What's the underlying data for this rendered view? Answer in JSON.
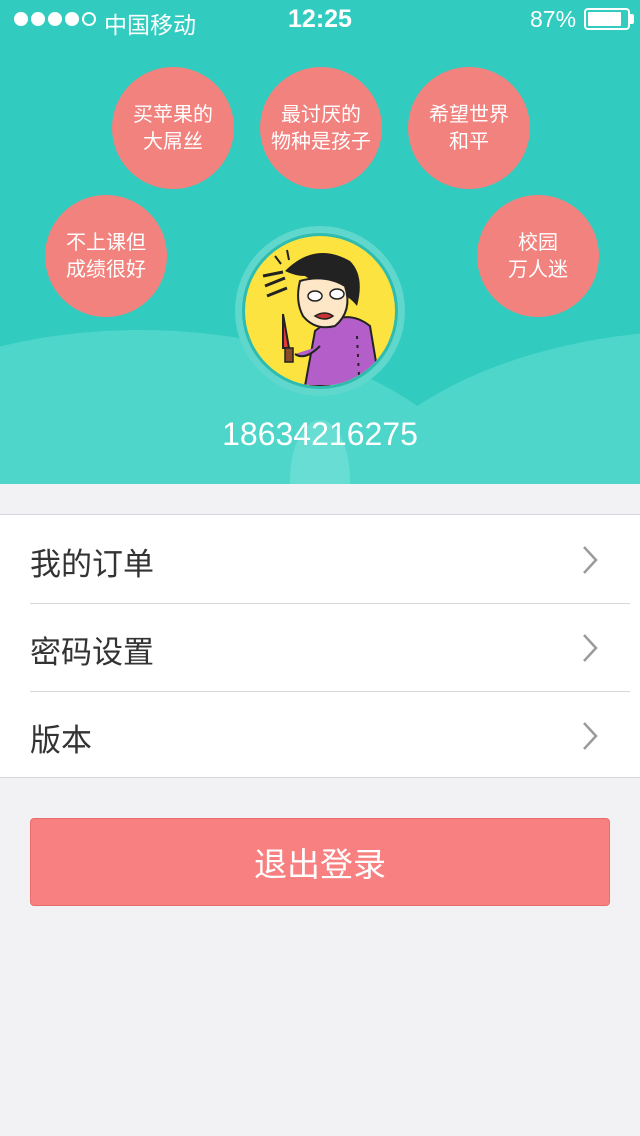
{
  "status_bar": {
    "carrier": "中国移动",
    "time": "12:25",
    "battery_percent": "87%",
    "battery_level": 0.87,
    "signal_bars": 4,
    "signal_total": 5
  },
  "profile": {
    "tags": [
      {
        "line1": "买苹果的",
        "line2": "大屌丝"
      },
      {
        "line1": "最讨厌的",
        "line2": "物种是孩子"
      },
      {
        "line1": "希望世界",
        "line2": "和平"
      },
      {
        "line1": "不上课但",
        "line2": "成绩很好"
      },
      {
        "line1": "校园",
        "line2": "万人迷"
      }
    ],
    "phone": "18634216275"
  },
  "menu": {
    "items": [
      {
        "label": "我的订单",
        "icon": "chevron-right-icon"
      },
      {
        "label": "密码设置",
        "icon": "chevron-right-icon"
      },
      {
        "label": "版本",
        "icon": "chevron-right-icon"
      }
    ]
  },
  "logout_label": "退出登录",
  "colors": {
    "header": "#31ccbf",
    "bubble": "#f2827e",
    "avatar_bg": "#fce33f",
    "logout": "#f88080",
    "page_bg": "#f2f2f4"
  }
}
